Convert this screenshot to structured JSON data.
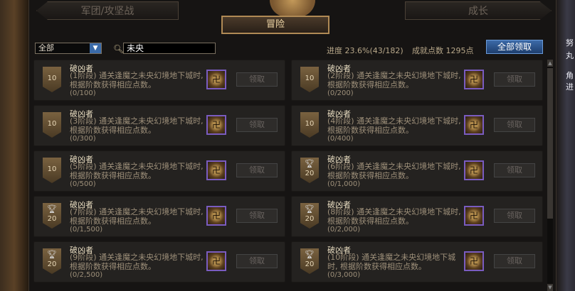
{
  "tabs": {
    "left": "军团/攻坚战",
    "right": "成长",
    "active": "冒险"
  },
  "filter": {
    "selected": "全部",
    "search_value": "未央"
  },
  "progress_text": "进度 23.6%(43/182)",
  "points_text": "成就点数 1295点",
  "claim_all_label": "全部领取",
  "side_texts": [
    "努",
    "丸",
    "角",
    "进"
  ],
  "achievements": [
    {
      "title": "破凶者",
      "desc": "(1阶段) 通关逢魔之未央幻境地下城时, 根据阶数获得相应点数。",
      "count": "(0/100)",
      "badge": "10",
      "trophy": false,
      "claim": "领取"
    },
    {
      "title": "破凶者",
      "desc": "(2阶段) 通关逢魔之未央幻境地下城时, 根据阶数获得相应点数。",
      "count": "(0/200)",
      "badge": "10",
      "trophy": false,
      "claim": "领取"
    },
    {
      "title": "破凶者",
      "desc": "(3阶段) 通关逢魔之未央幻境地下城时, 根据阶数获得相应点数。",
      "count": "(0/300)",
      "badge": "10",
      "trophy": false,
      "claim": "领取"
    },
    {
      "title": "破凶者",
      "desc": "(4阶段) 通关逢魔之未央幻境地下城时, 根据阶数获得相应点数。",
      "count": "(0/400)",
      "badge": "10",
      "trophy": false,
      "claim": "领取"
    },
    {
      "title": "破凶者",
      "desc": "(5阶段) 通关逢魔之未央幻境地下城时, 根据阶数获得相应点数。",
      "count": "(0/500)",
      "badge": "10",
      "trophy": false,
      "claim": "领取"
    },
    {
      "title": "破凶者",
      "desc": "(6阶段) 通关逢魔之未央幻境地下城时, 根据阶数获得相应点数。",
      "count": "(0/1,000)",
      "badge": "20",
      "trophy": true,
      "claim": "领取"
    },
    {
      "title": "破凶者",
      "desc": "(7阶段) 通关逢魔之未央幻境地下城时, 根据阶数获得相应点数。",
      "count": "(0/1,500)",
      "badge": "20",
      "trophy": true,
      "claim": "领取"
    },
    {
      "title": "破凶者",
      "desc": "(8阶段) 通关逢魔之未央幻境地下城时, 根据阶数获得相应点数。",
      "count": "(0/2,000)",
      "badge": "20",
      "trophy": true,
      "claim": "领取"
    },
    {
      "title": "破凶者",
      "desc": "(9阶段) 通关逢魔之未央幻境地下城时, 根据阶数获得相应点数。",
      "count": "(0/2,500)",
      "badge": "20",
      "trophy": true,
      "claim": "领取"
    },
    {
      "title": "破凶者",
      "desc": "(10阶段) 通关逢魔之未央幻境地下城时, 根据阶数获得相应点数。",
      "count": "(0/3,000)",
      "badge": "20",
      "trophy": true,
      "claim": "领取"
    }
  ]
}
